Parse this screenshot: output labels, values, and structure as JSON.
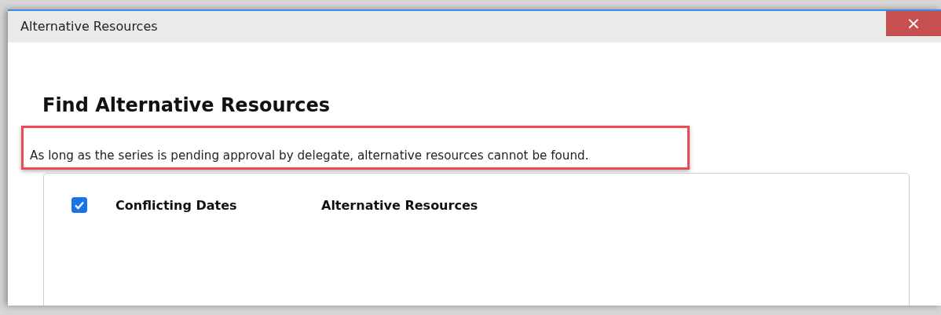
{
  "window": {
    "title": "Alternative Resources",
    "close": "×"
  },
  "heading": "Find Alternative Resources",
  "note": {
    "text": "As long as the series is pending approval by delegate, alternative resources cannot be found.",
    "highlighted": true
  },
  "table": {
    "select_all": {
      "checked": true
    },
    "columns": [
      "Conflicting Dates",
      "Alternative Resources"
    ]
  }
}
